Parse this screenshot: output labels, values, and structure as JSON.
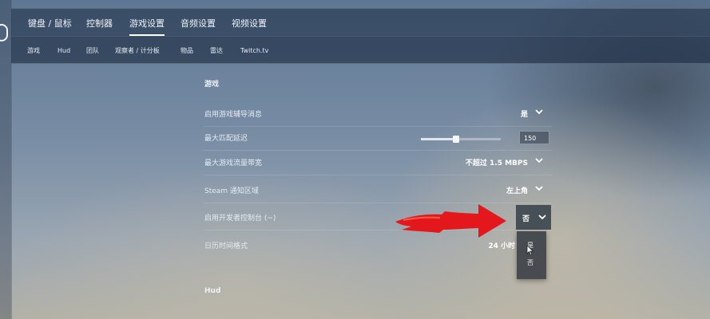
{
  "top_tabs": [
    {
      "label": "键盘 / 鼠标",
      "active": false
    },
    {
      "label": "控制器",
      "active": false
    },
    {
      "label": "游戏设置",
      "active": true
    },
    {
      "label": "音频设置",
      "active": false
    },
    {
      "label": "视频设置",
      "active": false
    }
  ],
  "sub_tabs": [
    "游戏",
    "Hud",
    "团队",
    "观察者 / 计分板",
    "物品",
    "雷达",
    "Twitch.tv"
  ],
  "section_game": "游戏",
  "rows": [
    {
      "label": "启用游戏辅导消息",
      "value": "是"
    },
    {
      "label": "最大匹配延迟",
      "slider_fraction": 0.42,
      "input_value": "150"
    },
    {
      "label": "最大游戏流量带宽",
      "value": "不超过 1.5 MBPS"
    },
    {
      "label": "Steam 通知区域",
      "value": "左上角"
    },
    {
      "label": "启用开发者控制台 (~)",
      "value": "否"
    },
    {
      "label": "日历时间格式",
      "value": "24 小时"
    }
  ],
  "dropdown_options": [
    "是",
    "否"
  ],
  "section_hud": "Hud",
  "icons": {
    "chevron": "chevron-down-icon",
    "cursor": "mouse-pointer-icon",
    "annotation": "red-arrow-annotation"
  },
  "colors": {
    "annotation_red": "#e3171c",
    "panel": "#24344a"
  }
}
